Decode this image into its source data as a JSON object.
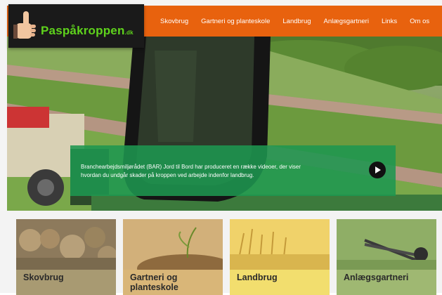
{
  "logo": {
    "text": "Paspåkroppen",
    "tld": ".dk"
  },
  "nav": {
    "items": [
      {
        "label": "Skovbrug"
      },
      {
        "label": "Gartneri og planteskole"
      },
      {
        "label": "Landbrug"
      },
      {
        "label": "Anlægsgartneri"
      },
      {
        "label": "Links"
      },
      {
        "label": "Om os"
      }
    ]
  },
  "hero": {
    "text": "Branchearbejdsmiljørådet (BAR) Jord til Bord har  produceret en række videoer, der viser hvordan du undgår skader på kroppen ved arbejde indenfor landbrug."
  },
  "cards": [
    {
      "title": "Skovbrug",
      "color": "#a89a72"
    },
    {
      "title": "Gartneri og planteskole",
      "color": "#d9b678"
    },
    {
      "title": "Landbrug",
      "color": "#f2de6e"
    },
    {
      "title": "Anlægsgartneri",
      "color": "#9fb872"
    }
  ],
  "colors": {
    "accent": "#e8620e",
    "logo_green": "#5fd31c",
    "banner": "#1e9650"
  }
}
